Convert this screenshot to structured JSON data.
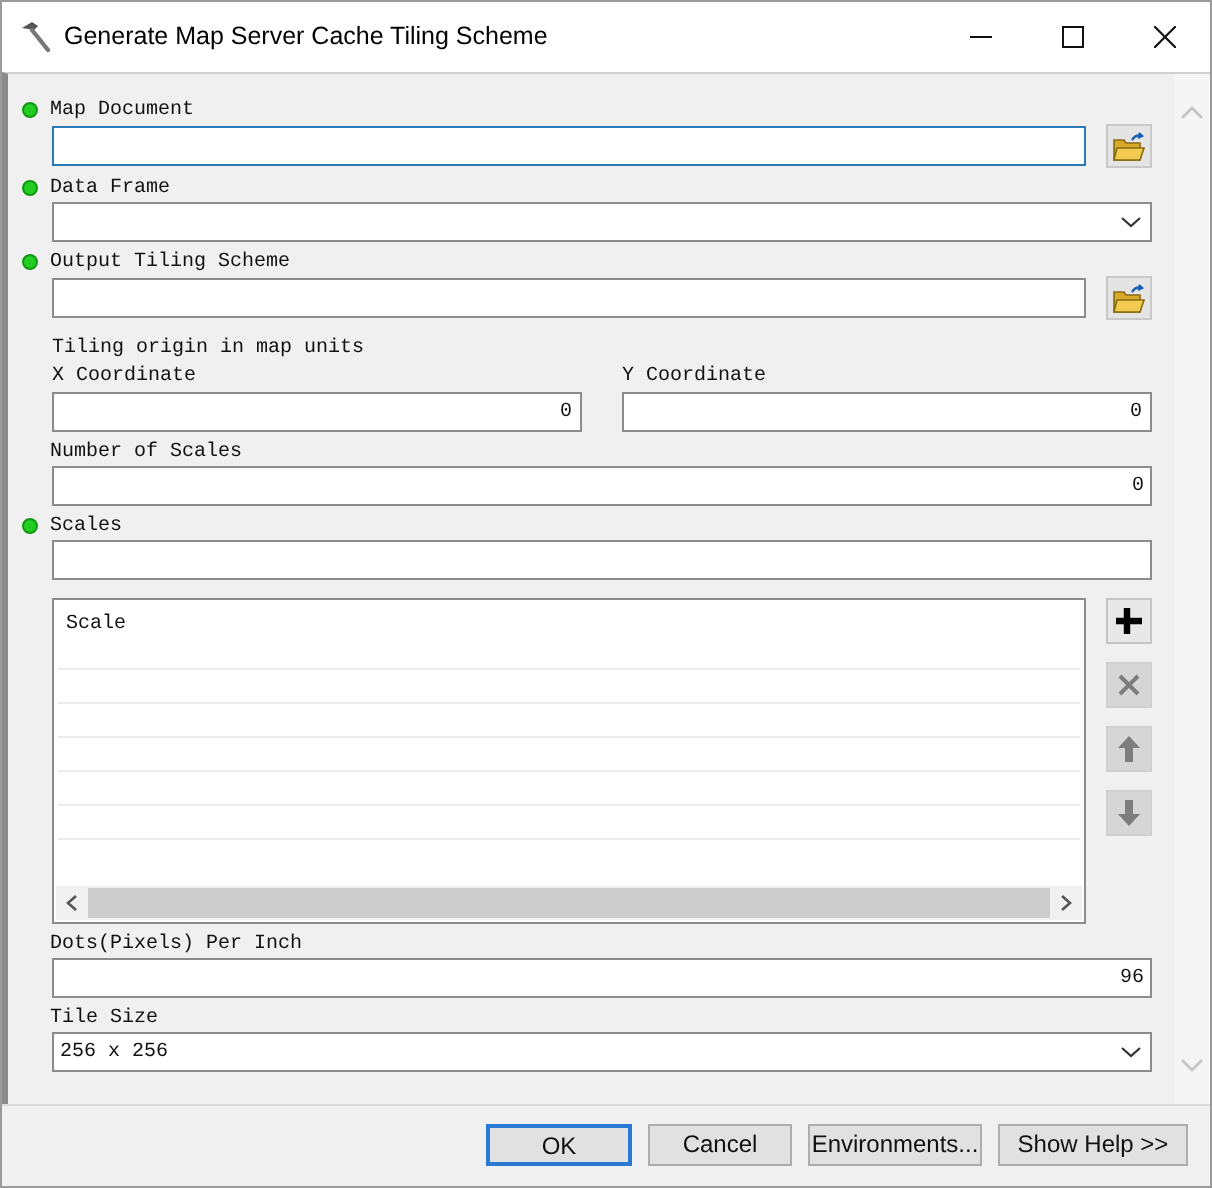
{
  "window": {
    "title": "Generate Map Server Cache Tiling Scheme"
  },
  "parameters": [
    {
      "kind": "path",
      "label": "Map Document",
      "required": true,
      "focused": true
    },
    {
      "kind": "dropdown",
      "label": "Data Frame",
      "required": true,
      "focused": false
    },
    {
      "kind": "path",
      "label": "Output Tiling Scheme",
      "required": true,
      "focused": false
    },
    {
      "kind": "heading",
      "label": "Tiling origin in map units"
    },
    {
      "kind": "pair",
      "fields": [
        {
          "label": "X Coordinate",
          "value": "0"
        },
        {
          "label": "Y Coordinate",
          "value": "0"
        }
      ]
    },
    {
      "kind": "number",
      "label": "Number of Scales",
      "required": false,
      "focused": false,
      "value": "0"
    },
    {
      "kind": "text",
      "label": "Scales",
      "required": true,
      "focused": false
    },
    {
      "kind": "list",
      "columns": [
        "Scale"
      ],
      "list_buttons": [
        {
          "kind": "add",
          "disabled": false
        },
        {
          "kind": "remove",
          "disabled": true
        },
        {
          "kind": "up",
          "disabled": true
        },
        {
          "kind": "down",
          "disabled": true
        }
      ]
    },
    {
      "kind": "number",
      "label": "Dots(Pixels) Per Inch",
      "required": false,
      "focused": false,
      "value": "96"
    },
    {
      "kind": "dropdown",
      "label": "Tile Size",
      "required": false,
      "focused": false,
      "value": "256 x 256"
    }
  ],
  "buttons": [
    {
      "label": "OK",
      "default": true
    },
    {
      "label": "Cancel",
      "default": false
    },
    {
      "label": "Environments...",
      "default": false
    },
    {
      "label": "Show Help >>",
      "default": false
    }
  ]
}
